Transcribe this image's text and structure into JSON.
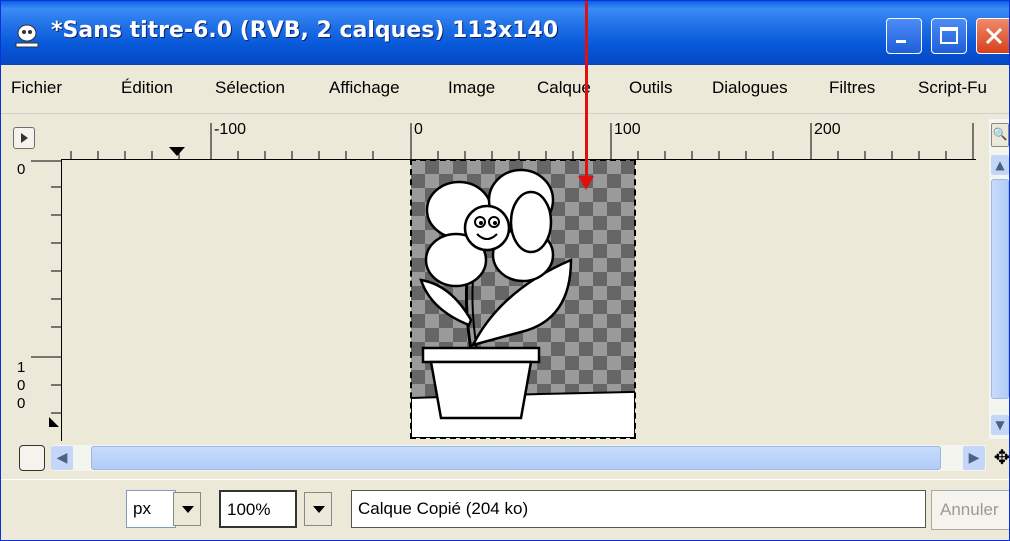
{
  "window": {
    "title": "*Sans titre-6.0 (RVB, 2 calques) 113x140"
  },
  "menubar": {
    "items": [
      "Fichier",
      "Édition",
      "Sélection",
      "Affichage",
      "Image",
      "Calque",
      "Outils",
      "Dialogues",
      "Filtres",
      "Script-Fu"
    ]
  },
  "ruler": {
    "horizontal_labels": [
      "-100",
      "0",
      "100",
      "200"
    ],
    "vertical_labels": [
      "0",
      "1",
      "0",
      "0"
    ]
  },
  "statusbar": {
    "unit": "px",
    "zoom": "100%",
    "layer_info": "Calque Copié (204 ko)",
    "cancel_label": "Annuler"
  },
  "colors": {
    "titlebar": "#0758d8",
    "window_bg": "#ece9d8",
    "annotation_arrow": "#e01010"
  },
  "icons": [
    "gimp-app-icon",
    "minimize-icon",
    "maximize-icon",
    "close-icon",
    "quick-mask-icon",
    "zoom-icon",
    "navigate-icon",
    "move-icon",
    "scroll-up-icon",
    "scroll-down-icon",
    "scroll-left-icon",
    "scroll-right-icon"
  ]
}
